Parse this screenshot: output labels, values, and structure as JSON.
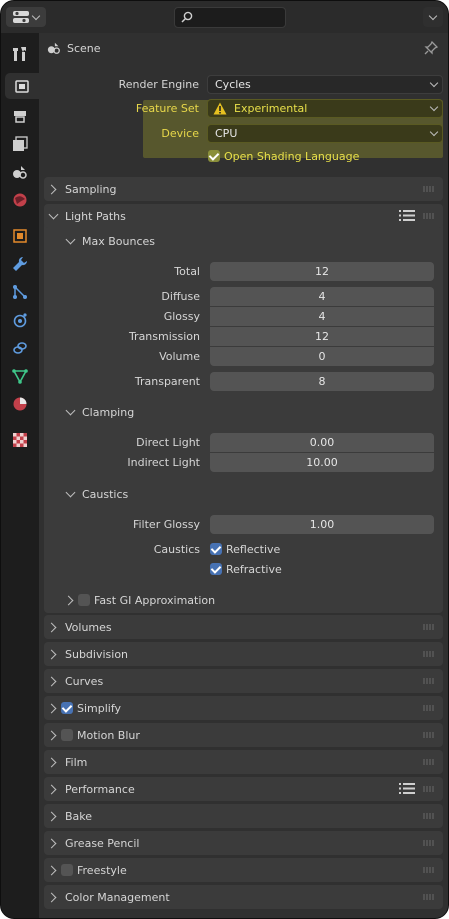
{
  "header": {
    "context_title": "Scene"
  },
  "render": {
    "engine_label": "Render Engine",
    "engine_value": "Cycles",
    "feature_label": "Feature Set",
    "feature_value": "Experimental",
    "device_label": "Device",
    "device_value": "CPU",
    "osl_label": "Open Shading Language"
  },
  "panels": {
    "sampling": "Sampling",
    "light_paths": "Light Paths",
    "max_bounces": "Max Bounces",
    "clamping": "Clamping",
    "caustics": "Caustics",
    "fast_gi": "Fast GI Approximation",
    "volumes": "Volumes",
    "subdivision": "Subdivision",
    "curves": "Curves",
    "simplify": "Simplify",
    "motion_blur": "Motion Blur",
    "film": "Film",
    "performance": "Performance",
    "bake": "Bake",
    "grease_pencil": "Grease Pencil",
    "freestyle": "Freestyle",
    "color_management": "Color Management"
  },
  "bounces": {
    "total_label": "Total",
    "total": "12",
    "diffuse_label": "Diffuse",
    "diffuse": "4",
    "glossy_label": "Glossy",
    "glossy": "4",
    "transmission_label": "Transmission",
    "transmission": "12",
    "volume_label": "Volume",
    "volume": "0",
    "transparent_label": "Transparent",
    "transparent": "8"
  },
  "clamping": {
    "direct_label": "Direct Light",
    "direct": "0.00",
    "indirect_label": "Indirect Light",
    "indirect": "10.00"
  },
  "caustics": {
    "filter_label": "Filter Glossy",
    "filter": "1.00",
    "caustics_label": "Caustics",
    "reflective": "Reflective",
    "refractive": "Refractive"
  },
  "colors": {
    "accent": "#4772b3",
    "warning": "#e6c020",
    "highlight": "#bebe28"
  }
}
